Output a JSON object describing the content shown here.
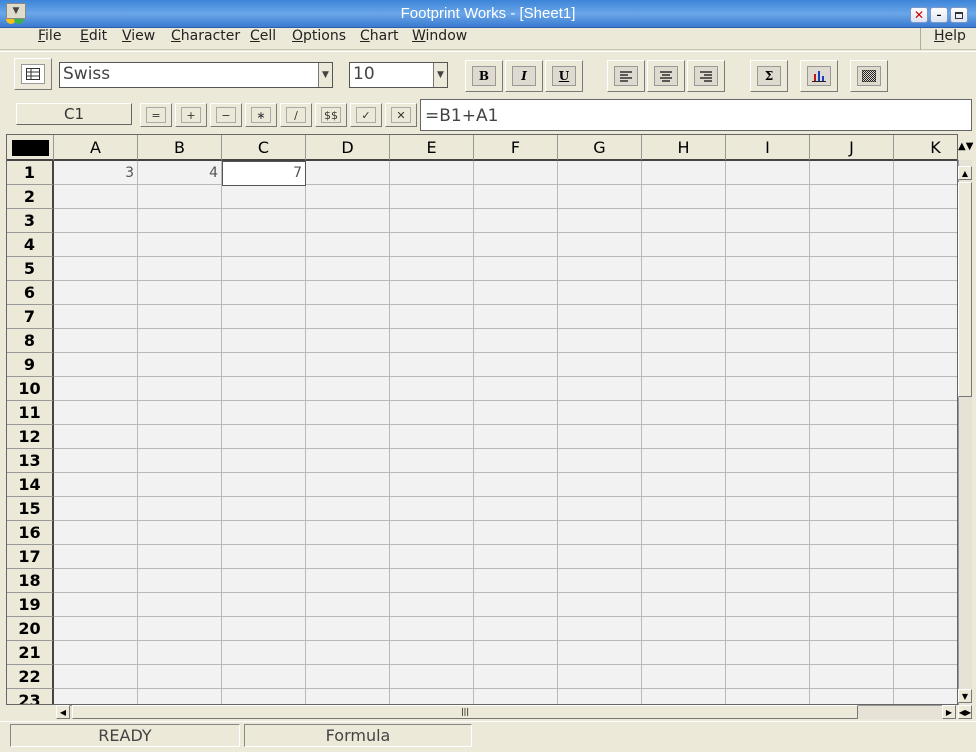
{
  "window": {
    "title": "Footprint Works - [Sheet1]"
  },
  "menu": [
    "File",
    "Edit",
    "View",
    "Character",
    "Cell",
    "Options",
    "Chart",
    "Window"
  ],
  "help": "Help",
  "toolbar": {
    "font": "Swiss",
    "size": "10",
    "bold": "B",
    "italic": "I",
    "underline": "U",
    "sum": "Σ"
  },
  "formula": {
    "cell_ref": "C1",
    "buttons": [
      "=",
      "+",
      "−",
      "∗",
      "∕",
      "$$",
      "✓",
      "✕"
    ],
    "content": "=B1+A1"
  },
  "grid": {
    "columns": [
      "A",
      "B",
      "C",
      "D",
      "E",
      "F",
      "G",
      "H",
      "I",
      "J",
      "K"
    ],
    "rows": [
      "1",
      "2",
      "3",
      "4",
      "5",
      "6",
      "7",
      "8",
      "9",
      "10",
      "11",
      "12",
      "13",
      "14",
      "15",
      "16",
      "17",
      "18",
      "19",
      "20",
      "21",
      "22",
      "23"
    ],
    "cells": {
      "A1": "3",
      "B1": "4",
      "C1": "7"
    }
  },
  "status": {
    "mode": "READY",
    "type": "Formula"
  },
  "colors": {
    "title_bar": "#4a8ddc",
    "background": "#ece9d8",
    "cell": "#f2f2f2"
  }
}
